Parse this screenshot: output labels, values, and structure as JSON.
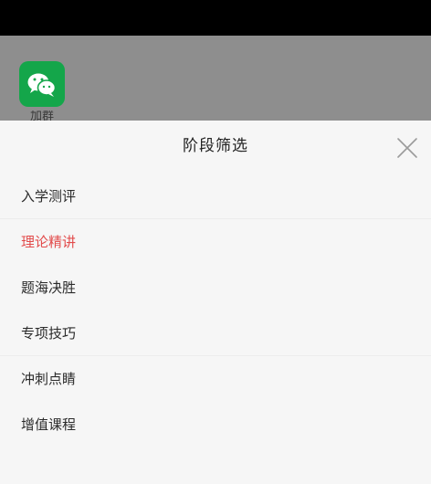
{
  "background_app": {
    "icon_name": "wechat-icon",
    "icon_color": "#14a64a",
    "label": "加群"
  },
  "sheet": {
    "title": "阶段筛选",
    "close_icon": "close-icon",
    "accent_color": "#e24b4b",
    "items": [
      {
        "label": "入学测评",
        "selected": false
      },
      {
        "label": "理论精讲",
        "selected": true
      },
      {
        "label": "题海决胜",
        "selected": false
      },
      {
        "label": "专项技巧",
        "selected": false
      },
      {
        "label": "冲刺点睛",
        "selected": false
      },
      {
        "label": "增值课程",
        "selected": false
      }
    ]
  }
}
